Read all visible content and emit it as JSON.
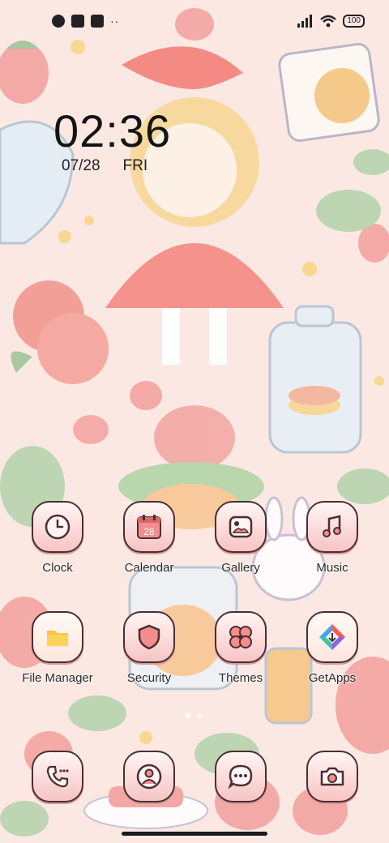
{
  "status_bar": {
    "left_icons": [
      "notification-icon",
      "app-icon",
      "download-icon"
    ],
    "more_indicator": "··",
    "right_icons": [
      "signal-icon",
      "wifi-icon",
      "battery-icon"
    ],
    "battery_level": "100"
  },
  "clock": {
    "time": "02:36",
    "date": "07/28",
    "weekday": "FRI"
  },
  "apps_row1": [
    {
      "label": "Clock",
      "icon": "clock-icon"
    },
    {
      "label": "Calendar",
      "icon": "calendar-icon",
      "icon_text": "28"
    },
    {
      "label": "Gallery",
      "icon": "gallery-icon"
    },
    {
      "label": "Music",
      "icon": "music-icon"
    }
  ],
  "apps_row2": [
    {
      "label": "File Manager",
      "icon": "folder-icon"
    },
    {
      "label": "Security",
      "icon": "shield-icon"
    },
    {
      "label": "Themes",
      "icon": "flower-icon"
    },
    {
      "label": "GetApps",
      "icon": "getapps-icon"
    }
  ],
  "dock": [
    {
      "icon": "phone-icon"
    },
    {
      "icon": "contacts-icon"
    },
    {
      "icon": "messages-icon"
    },
    {
      "icon": "camera-icon"
    }
  ],
  "pager": {
    "pages": 2,
    "current": 1
  },
  "colors": {
    "icon_stroke": "#4a2e32",
    "icon_fill": "#f7c4c4",
    "background": "#fce8e2"
  }
}
